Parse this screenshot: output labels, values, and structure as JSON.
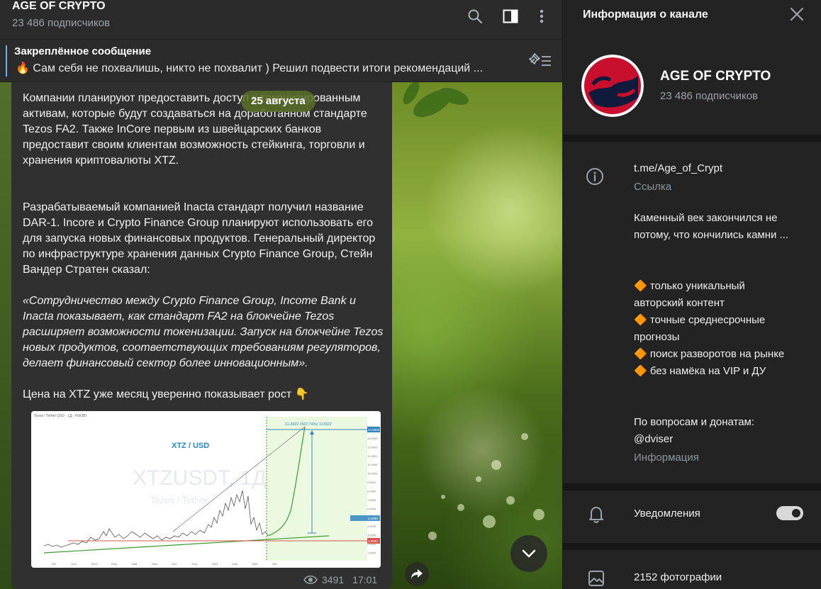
{
  "header": {
    "title": "AGE OF CRYPTO",
    "subscribers": "23 486 подписчиков"
  },
  "pinned": {
    "title": "Закреплённое сообщение",
    "emoji": "🔥",
    "text": "Сам себя не похвалишь, никто не похвалит ) Решил подвести итоги рекомендаций ..."
  },
  "message": {
    "date": "25 августа",
    "p1": "Компании планируют предоставить доступ к токенизированным активам, которые будут создаваться на доработанном стандарте Tezos FA2. Также InCore первым из швейцарских банков предоставит своим клиентам возможность стейкинга, торговли и хранения криптовалюты XTZ.",
    "p2": "Разрабатываемый компанией Inacta стандарт получил название DAR-1. Incore и Crypto Finance Group планируют использовать его для запуска новых финансовых продуктов. Генеральный директор по инфраструктуре хранения данных Crypto Finance Group, Стейн Вандер Стратен сказал:",
    "quote": "«Сотрудничество между Crypto Finance Group, Income Bank и Inacta показывает, как стандарт FA2 на блокчейне Tezos расширяет возможности токенизации. Запуск на блокчейне Tezos новых продуктов, соответствующих требованиям регуляторов, делает финансовый сектор более инновационным».",
    "p3": "Цена на XTZ уже месяц уверенно показывает рост 👇",
    "views": "3491",
    "time": "17:01"
  },
  "chart_image": {
    "caption": "XTZ / USD",
    "watermark": "XTZUSDT, 1Д",
    "watermark_sub": "Tezos / Tether",
    "header_text": "Tezos / Tether USD · 1Д · HUOBI",
    "target_label": "11.3922 (422.74%) 113922",
    "price_tag_top": "14.5000",
    "price_tag_mid": "2.4680",
    "price_tag_low": "1.9000",
    "y_ticks": [
      "15.0000",
      "14.0000",
      "13.0000",
      "12.0000",
      "11.0000",
      "10.0000",
      "9.0000",
      "8.0000",
      "7.0000",
      "6.0000",
      "5.0000",
      "4.0000",
      "3.0000",
      "2.0000",
      "1.0000"
    ],
    "x_ticks": [
      "Сен",
      "Ноя",
      "2020",
      "Мар",
      "Май",
      "Июл",
      "Сен",
      "Ноя",
      "2021",
      "Мар",
      "Май",
      "Авг"
    ],
    "colors": {
      "green": "#3b9b2f",
      "blue": "#2e86c1",
      "red": "#d9534f",
      "zone": "#eaf9e0"
    }
  },
  "panel": {
    "title": "Информация о канале",
    "channel_name": "AGE OF CRYPTO",
    "subscribers": "23 486 подписчиков",
    "link": "t.me/Age_of_Crypt",
    "link_caption": "Ссылка",
    "desc_1": "Каменный век закончился не потому, что кончились камни ...",
    "bullets": [
      "только уникальный авторский контент",
      "точные среднесрочные прогнозы",
      "поиск разворотов на рынке",
      "без намёка на VIP и ДУ"
    ],
    "bullet_icon": "🔶",
    "contact_1": "По вопросам и донатам:",
    "contact_2": "@dviser",
    "info_caption": "Информация",
    "notifications": "Уведомления",
    "photos": "2152 фотографии"
  }
}
